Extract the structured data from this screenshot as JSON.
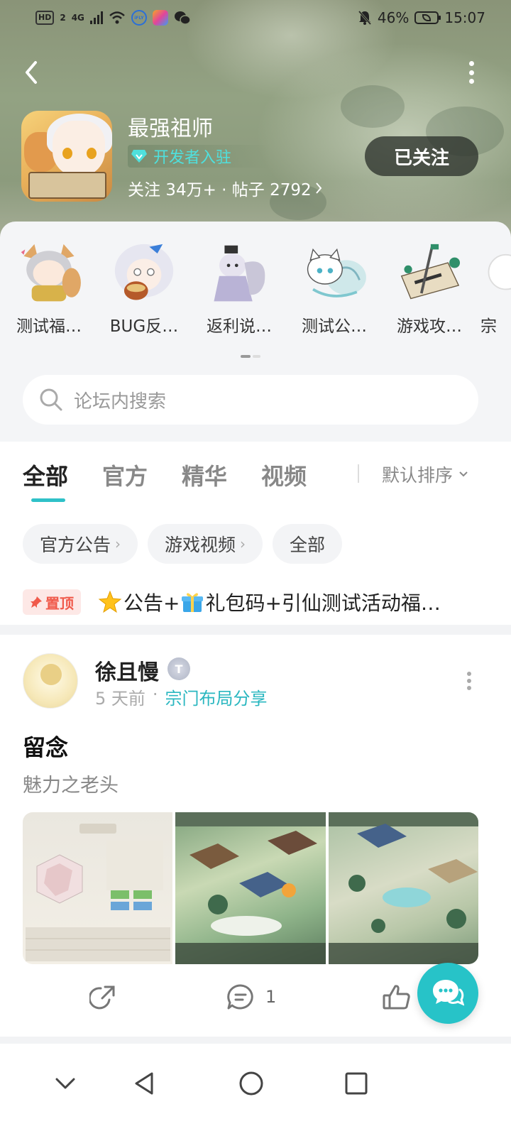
{
  "status_bar": {
    "network": "HD",
    "sim": "2",
    "signal": "4G",
    "app_badge": "iFLY",
    "battery": "46%",
    "time": "15:07"
  },
  "header": {
    "game_title": "最强祖师",
    "dev_badge": "开发者入驻",
    "stats": "关注 34万+ · 帖子 2792",
    "follow_button": "已关注",
    "icons": {
      "back": "back-arrow-icon",
      "more": "more-vertical-icon"
    }
  },
  "boards": [
    {
      "label": "测试福…",
      "icon": "fox-girl-board-icon"
    },
    {
      "label": "BUG反…",
      "icon": "silver-hair-board-icon"
    },
    {
      "label": "返利说…",
      "icon": "cat-sage-board-icon"
    },
    {
      "label": "测试公…",
      "icon": "spirit-cat-board-icon"
    },
    {
      "label": "游戏攻…",
      "icon": "scroll-sword-board-icon"
    },
    {
      "label": "宗",
      "icon": "partial-board-icon"
    }
  ],
  "search": {
    "placeholder": "论坛内搜索"
  },
  "tabs": [
    {
      "label": "全部",
      "active": true
    },
    {
      "label": "官方",
      "active": false
    },
    {
      "label": "精华",
      "active": false
    },
    {
      "label": "视频",
      "active": false
    }
  ],
  "sort_label": "默认排序",
  "chips": [
    {
      "label": "官方公告",
      "arrow": "›"
    },
    {
      "label": "游戏视频",
      "arrow": "›"
    },
    {
      "label": "全部",
      "arrow": ""
    }
  ],
  "pinned": {
    "badge": "置顶",
    "text": "公告+",
    "text2": "礼包码+引仙测试活动福…"
  },
  "post": {
    "username": "徐且慢",
    "level_badge": "T",
    "time": "5 天前",
    "separator": "·",
    "category": "宗门布局分享",
    "title": "留念",
    "body": "魅力之老头",
    "comments": "1",
    "likes": ""
  },
  "colors": {
    "accent": "#27c3c8",
    "pinned_red": "#f05a4b",
    "dev_badge": "#4fe0dd"
  }
}
